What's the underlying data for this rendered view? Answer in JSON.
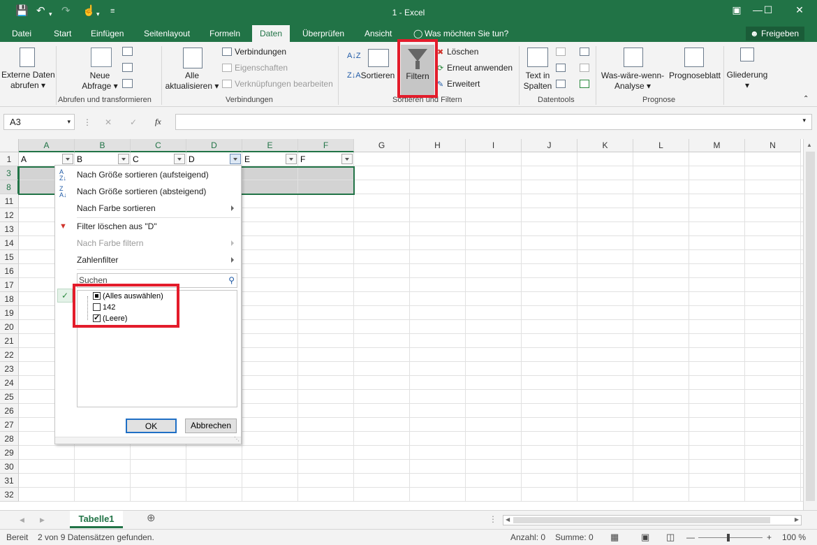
{
  "window": {
    "title": "1 - Excel"
  },
  "tabs": [
    {
      "label": "Datei"
    },
    {
      "label": "Start"
    },
    {
      "label": "Einfügen"
    },
    {
      "label": "Seitenlayout"
    },
    {
      "label": "Formeln"
    },
    {
      "label": "Daten"
    },
    {
      "label": "Überprüfen"
    },
    {
      "label": "Ansicht"
    }
  ],
  "tell_me": "Was möchten Sie tun?",
  "share": "Freigeben",
  "ribbon": {
    "external_data": [
      "Externe Daten",
      "abrufen"
    ],
    "new_query": [
      "Neue",
      "Abfrage"
    ],
    "group_get": "Abrufen und transformieren",
    "refresh_all": [
      "Alle",
      "aktualisieren"
    ],
    "connections": "Verbindungen",
    "properties": "Eigenschaften",
    "edit_links": "Verknüpfungen bearbeiten",
    "group_connections": "Verbindungen",
    "sort": "Sortieren",
    "filter": "Filtern",
    "clear": "Löschen",
    "reapply": "Erneut anwenden",
    "advanced": "Erweitert",
    "group_sort": "Sortieren und Filtern",
    "text_to_columns": [
      "Text in",
      "Spalten"
    ],
    "group_tools": "Datentools",
    "what_if": [
      "Was-wäre-wenn-",
      "Analyse"
    ],
    "forecast_sheet": "Prognoseblatt",
    "group_forecast": "Prognose",
    "outline": "Gliederung"
  },
  "namebox": "A3",
  "columns": [
    "A",
    "B",
    "C",
    "D",
    "E",
    "F",
    "G",
    "H",
    "I",
    "J",
    "K",
    "L",
    "M",
    "N"
  ],
  "rows": [
    "1",
    "3",
    "8",
    "11",
    "12",
    "13",
    "14",
    "15",
    "16",
    "17",
    "18",
    "19",
    "20",
    "21",
    "22",
    "23",
    "24",
    "25",
    "26",
    "27",
    "28",
    "29",
    "30",
    "31",
    "32"
  ],
  "header_cells": [
    "A",
    "B",
    "C",
    "D",
    "E",
    "F"
  ],
  "menu": {
    "sort_asc": "Nach Größe sortieren (aufsteigend)",
    "sort_desc": "Nach Größe sortieren (absteigend)",
    "sort_color": "Nach Farbe sortieren",
    "clear_filter": "Filter löschen aus \"D\"",
    "filter_color": "Nach Farbe filtern",
    "number_filter": "Zahlenfilter",
    "search_placeholder": "Suchen",
    "items": [
      {
        "label": "(Alles auswählen)",
        "state": "partial"
      },
      {
        "label": "142",
        "state": "unchecked"
      },
      {
        "label": "(Leere)",
        "state": "checked"
      }
    ],
    "ok": "OK",
    "cancel": "Abbrechen"
  },
  "sheet_tab": "Tabelle1",
  "status": {
    "ready": "Bereit",
    "found": "2 von 9 Datensätzen gefunden.",
    "count": "Anzahl: 0",
    "sum": "Summe: 0",
    "zoom": "100 %"
  },
  "colors": {
    "brand": "#217346",
    "highlight": "#e31c2b"
  }
}
